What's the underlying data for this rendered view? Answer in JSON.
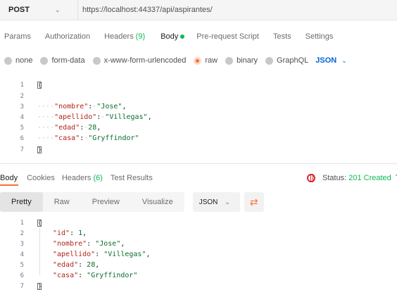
{
  "request": {
    "method": "POST",
    "url": "https://localhost:44337/api/aspirantes/"
  },
  "request_tabs": [
    {
      "label": "Params"
    },
    {
      "label": "Authorization"
    },
    {
      "label": "Headers",
      "count": "(9)"
    },
    {
      "label": "Body"
    },
    {
      "label": "Pre-request Script"
    },
    {
      "label": "Tests"
    },
    {
      "label": "Settings"
    }
  ],
  "body_types": [
    "none",
    "form-data",
    "x-www-form-urlencoded",
    "raw",
    "binary",
    "GraphQL"
  ],
  "body_format": "JSON",
  "request_body": {
    "line_numbers": [
      "1",
      "2",
      "3",
      "4",
      "5",
      "6",
      "7"
    ],
    "open_brace": "{",
    "close_brace": "}",
    "fields": [
      {
        "key": "\"nombre\"",
        "value": "\"Jose\"",
        "sep": ","
      },
      {
        "key": "\"apellido\"",
        "value": "\"Villegas\"",
        "sep": ","
      },
      {
        "key": "\"edad\"",
        "value": "28",
        "sep": ","
      },
      {
        "key": "\"casa\"",
        "value": "\"Gryffindor\"",
        "sep": ""
      }
    ]
  },
  "response_tabs": [
    {
      "label": "Body"
    },
    {
      "label": "Cookies"
    },
    {
      "label": "Headers",
      "count": "(6)"
    },
    {
      "label": "Test Results"
    }
  ],
  "status": {
    "label": "Status:",
    "value": "201 Created",
    "trunc": "T"
  },
  "response_views": [
    "Pretty",
    "Raw",
    "Preview",
    "Visualize"
  ],
  "response_format": "JSON",
  "response_body": {
    "line_numbers": [
      "1",
      "2",
      "3",
      "4",
      "5",
      "6",
      "7"
    ],
    "open_brace": "{",
    "close_brace": "}",
    "fields": [
      {
        "key": "\"id\"",
        "value": "1",
        "sep": ","
      },
      {
        "key": "\"nombre\"",
        "value": "\"Jose\"",
        "sep": ","
      },
      {
        "key": "\"apellido\"",
        "value": "\"Villegas\"",
        "sep": ","
      },
      {
        "key": "\"edad\"",
        "value": "28",
        "sep": ","
      },
      {
        "key": "\"casa\"",
        "value": "\"Gryffindor\"",
        "sep": ""
      }
    ]
  },
  "colors": {
    "accent": "#ff6c37",
    "success": "#0cbb52",
    "link": "#0265d2",
    "key": "#b2231a",
    "string": "#0a6d2e"
  }
}
